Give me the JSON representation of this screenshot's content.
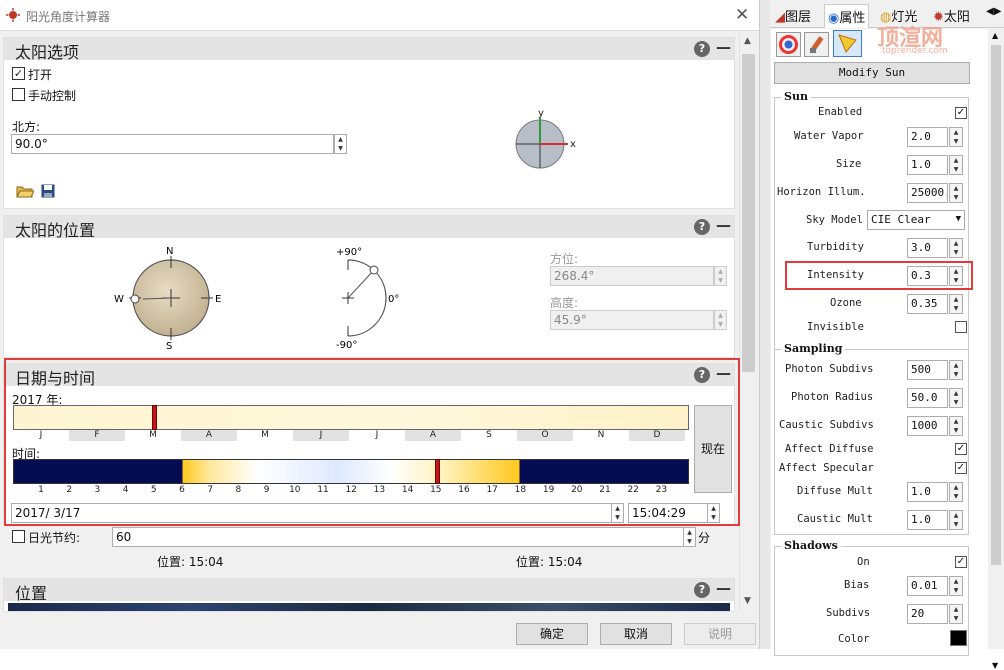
{
  "window": {
    "title": "阳光角度计算器"
  },
  "sun_options": {
    "title": "太阳选项",
    "on_label": "打开",
    "on_checked": true,
    "manual_label": "手动控制",
    "manual_checked": false,
    "north_label": "北方:",
    "north_value": "90.0°",
    "axis_y": "y",
    "axis_x": "x"
  },
  "sun_position": {
    "title": "太阳的位置",
    "compass": {
      "n": "N",
      "e": "E",
      "s": "S",
      "w": "W"
    },
    "alt_top": "+90°",
    "alt_mid": "0°",
    "alt_bottom": "-90°",
    "azimuth_label": "方位:",
    "azimuth_value": "268.4°",
    "altitude_label": "高度:",
    "altitude_value": "45.9°"
  },
  "date_time": {
    "title": "日期与时间",
    "year_label": "2017 年:",
    "months": [
      "J",
      "F",
      "M",
      "A",
      "M",
      "J",
      "J",
      "A",
      "S",
      "O",
      "N",
      "D"
    ],
    "time_label": "时间:",
    "hours": [
      "1",
      "2",
      "3",
      "4",
      "5",
      "6",
      "7",
      "8",
      "9",
      "10",
      "11",
      "12",
      "13",
      "14",
      "15",
      "16",
      "17",
      "18",
      "19",
      "20",
      "21",
      "22",
      "23"
    ],
    "now_button": "现在",
    "date_value": "2017/  3/17",
    "time_value": "15:04:29"
  },
  "daylight": {
    "label": "日光节约:",
    "checked": false,
    "value": "60",
    "unit": "分",
    "pos_left": "位置: 15:04",
    "pos_right": "位置: 15:04"
  },
  "location": {
    "title": "位置"
  },
  "buttons": {
    "ok": "确定",
    "cancel": "取消",
    "help": "说明"
  },
  "right_panel": {
    "tabs": [
      "图层",
      "属性",
      "灯光",
      "太阳"
    ],
    "active_tab": "属性",
    "watermark": "顶渲网",
    "watermark_sub": "toprender.com",
    "modify_button": "Modify Sun",
    "sun_group": {
      "title": "Sun",
      "enabled_label": "Enabled",
      "enabled": true,
      "water_vapor_label": "Water Vapor",
      "water_vapor": "2.0",
      "size_label": "Size",
      "size": "1.0",
      "horizon_label": "Horizon Illum.",
      "horizon": "25000.0",
      "sky_model_label": "Sky Model",
      "sky_model": "CIE Clear",
      "turbidity_label": "Turbidity",
      "turbidity": "3.0",
      "intensity_label": "Intensity",
      "intensity": "0.3",
      "ozone_label": "Ozone",
      "ozone": "0.35",
      "invisible_label": "Invisible",
      "invisible": false
    },
    "sampling_group": {
      "title": "Sampling",
      "photon_subdivs_label": "Photon Subdivs",
      "photon_subdivs": "500",
      "photon_radius_label": "Photon Radius",
      "photon_radius": "50.0",
      "caustic_subdivs_label": "Caustic Subdivs",
      "caustic_subdivs": "1000",
      "affect_diffuse_label": "Affect Diffuse",
      "affect_diffuse": true,
      "affect_specular_label": "Affect Specular",
      "affect_specular": true,
      "diffuse_mult_label": "Diffuse Mult",
      "diffuse_mult": "1.0",
      "caustic_mult_label": "Caustic Mult",
      "caustic_mult": "1.0"
    },
    "shadows_group": {
      "title": "Shadows",
      "on_label": "On",
      "on": true,
      "bias_label": "Bias",
      "bias": "0.01",
      "subdivs_label": "Subdivs",
      "subdivs": "20",
      "color_label": "Color",
      "color": "#000000"
    }
  },
  "colors": {
    "highlight": "#e03c3c",
    "section_header": "#e4e4e4",
    "night": "#050c52",
    "day": "#ffc81e"
  }
}
